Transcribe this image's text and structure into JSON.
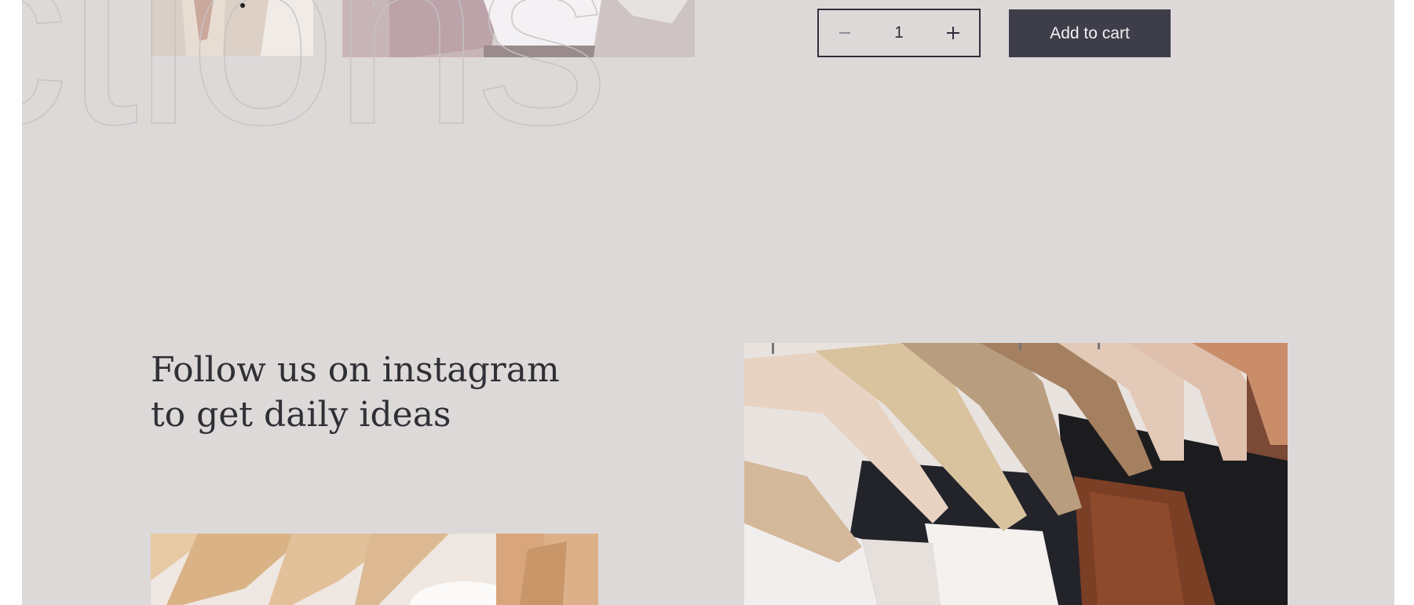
{
  "background_word": "ctions",
  "product": {
    "quantity": {
      "decrease_icon": "minus-icon",
      "value": "1",
      "increase_icon": "plus-icon"
    },
    "add_to_cart_label": "Add to cart"
  },
  "instagram": {
    "heading_line1": "Follow us on instagram",
    "heading_line2": "to get daily ideas"
  },
  "colors": {
    "page_background": "#ddd9d9",
    "button_background": "#3e3d4a",
    "text": "#2f2f36"
  }
}
